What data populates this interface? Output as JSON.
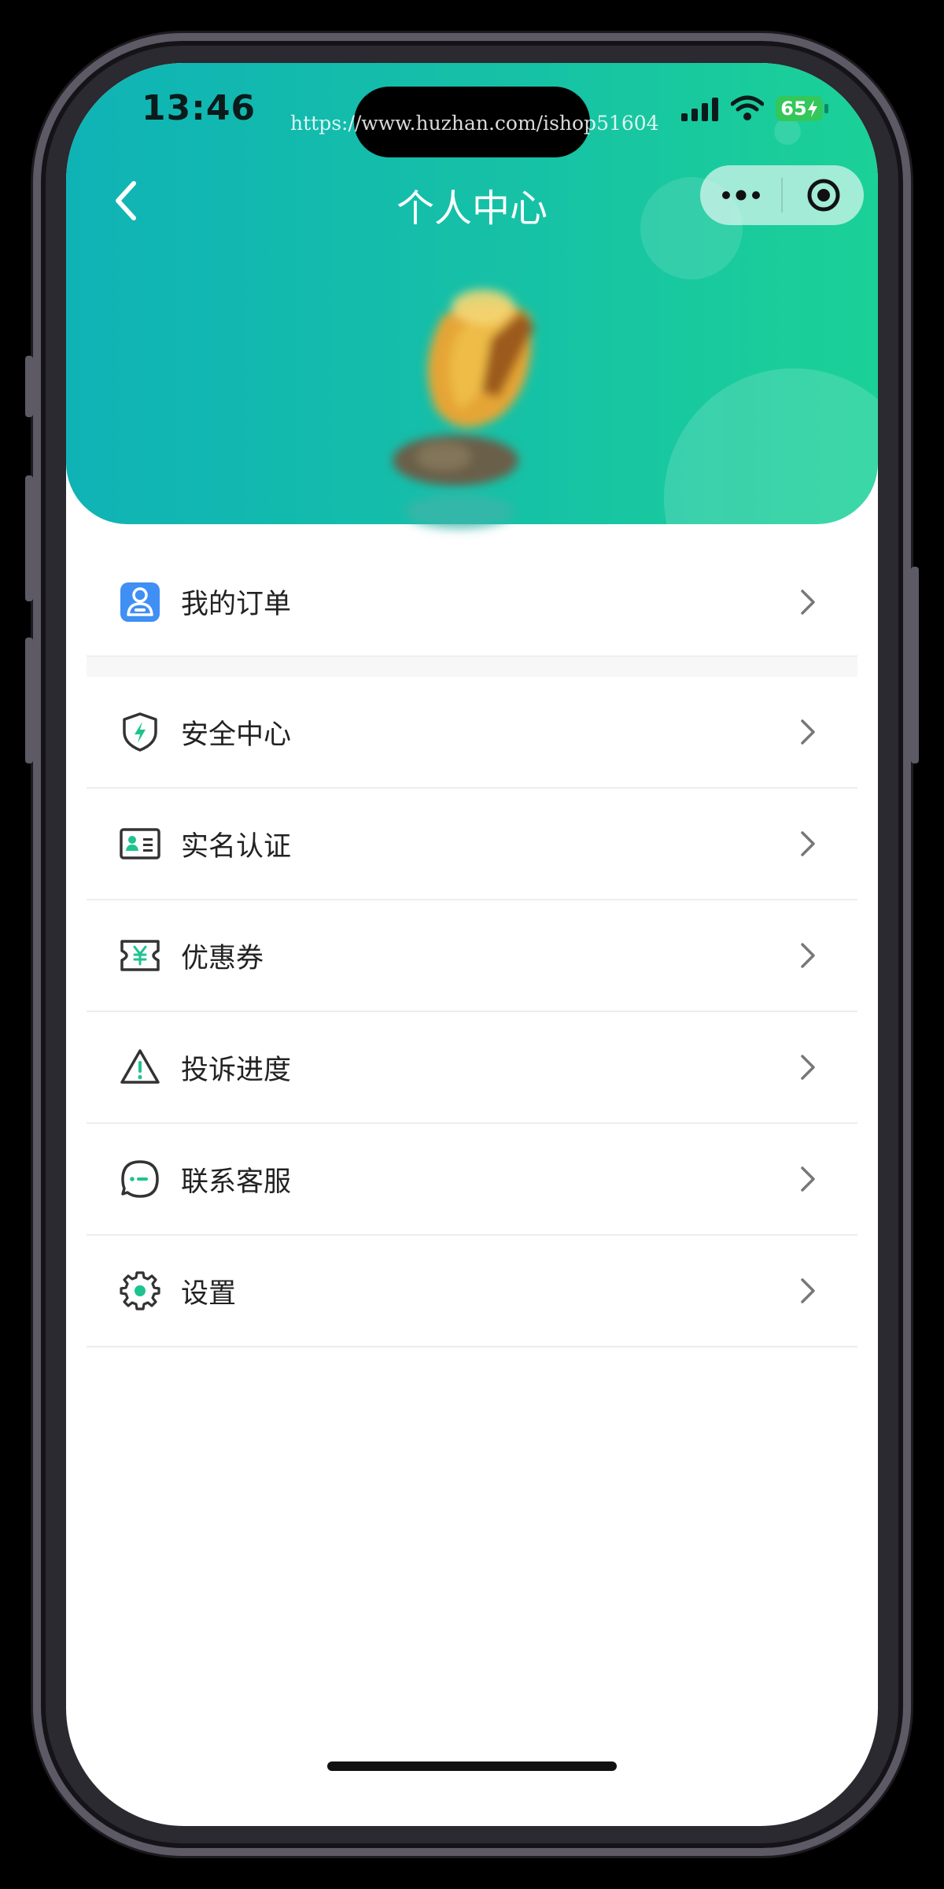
{
  "status_bar": {
    "time": "13:46",
    "battery": "65",
    "watermark": "https://www.huzhan.com/ishop51604"
  },
  "header": {
    "title": "个人中心"
  },
  "menu": {
    "items": [
      {
        "label": "我的订单",
        "icon": "user-order-icon"
      },
      {
        "label": "安全中心",
        "icon": "shield-bolt-icon"
      },
      {
        "label": "实名认证",
        "icon": "id-card-icon"
      },
      {
        "label": "优惠券",
        "icon": "coupon-yen-icon"
      },
      {
        "label": "投诉进度",
        "icon": "warning-triangle-icon"
      },
      {
        "label": "联系客服",
        "icon": "chat-bubble-icon"
      },
      {
        "label": "设置",
        "icon": "gear-icon"
      }
    ]
  },
  "colors": {
    "header_start": "#0fb3b6",
    "header_end": "#1bd197",
    "accent_green": "#1ec38f",
    "order_icon_blue": "#3f8ff5"
  }
}
